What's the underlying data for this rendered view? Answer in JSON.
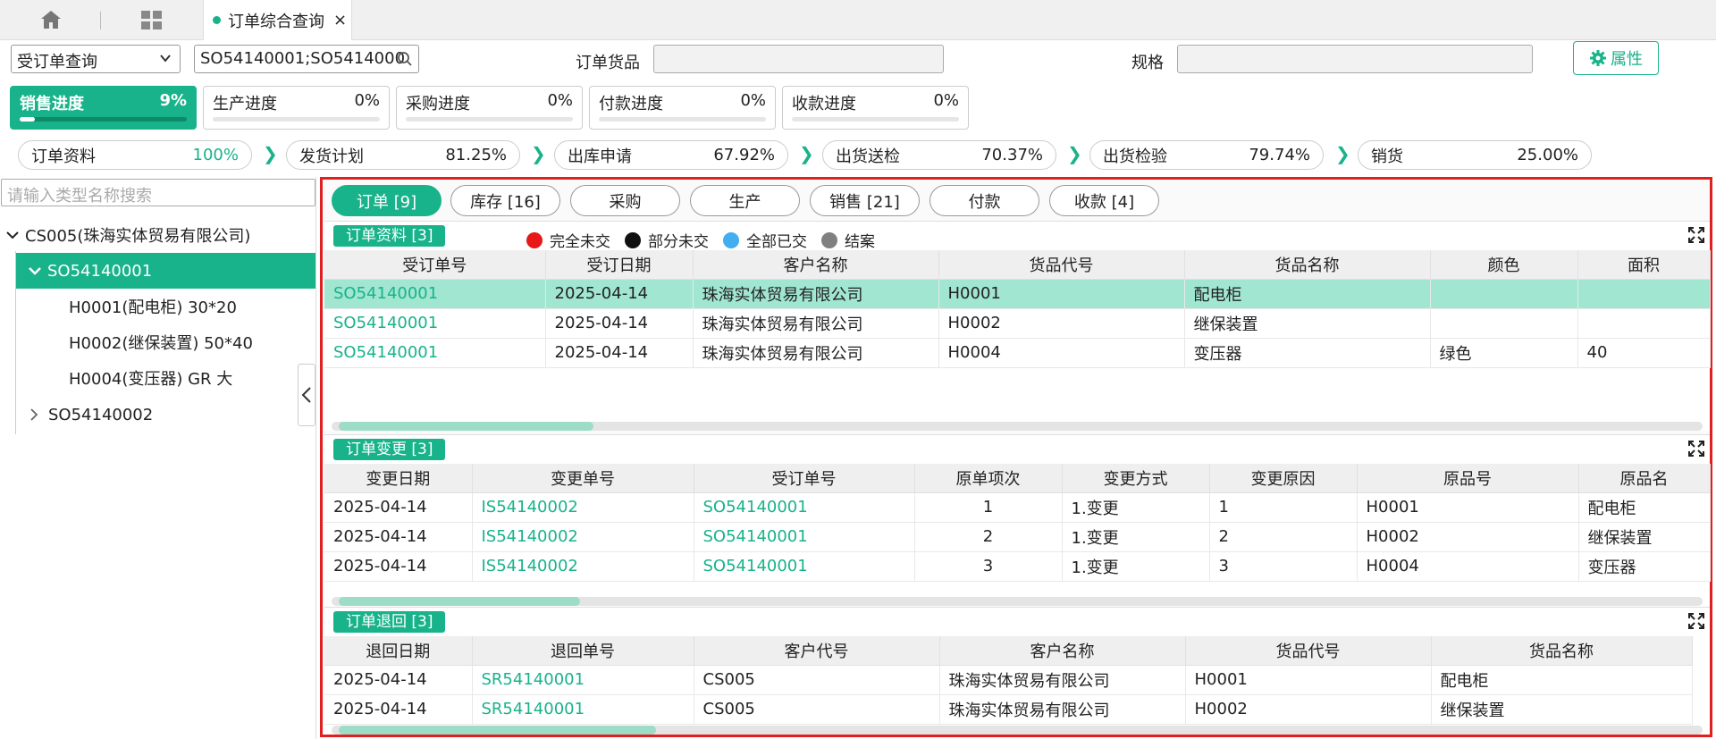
{
  "topbar": {
    "tab_label": "订单综合查询",
    "close": "×"
  },
  "filters": {
    "query_type": "受订单查询",
    "search_value": "SO54140001;SO5414000",
    "goods_label": "订单货品",
    "spec_label": "规格",
    "attr_button": "属性"
  },
  "progress": [
    {
      "label": "销售进度",
      "value": "9%",
      "fraction": 0.09
    },
    {
      "label": "生产进度",
      "value": "0%",
      "fraction": 0
    },
    {
      "label": "采购进度",
      "value": "0%",
      "fraction": 0
    },
    {
      "label": "付款进度",
      "value": "0%",
      "fraction": 0
    },
    {
      "label": "收款进度",
      "value": "0%",
      "fraction": 0
    }
  ],
  "steps": [
    {
      "label": "订单资料",
      "value": "100%"
    },
    {
      "label": "发货计划",
      "value": "81.25%"
    },
    {
      "label": "出库申请",
      "value": "67.92%"
    },
    {
      "label": "出货送检",
      "value": "70.37%"
    },
    {
      "label": "出货检验",
      "value": "79.74%"
    },
    {
      "label": "销货",
      "value": "25.00%"
    }
  ],
  "left": {
    "search_placeholder": "请输入类型名称搜索",
    "tree": {
      "root": "CS005(珠海实体贸易有限公司)",
      "order1": "SO54140001",
      "items": [
        "H0001(配电柜) 30*20",
        "H0002(继保装置) 50*40",
        "H0004(变压器) GR 大"
      ],
      "order2": "SO54140002"
    }
  },
  "panel_tabs": [
    "订单 [9]",
    "库存 [16]",
    "采购",
    "生产",
    "销售 [21]",
    "付款",
    "收款 [4]"
  ],
  "order_section": {
    "title": "订单资料 [3]",
    "legend": [
      {
        "label": "完全未交",
        "color": "#e81818"
      },
      {
        "label": "部分未交",
        "color": "#111111"
      },
      {
        "label": "全部已交",
        "color": "#40aef0"
      },
      {
        "label": "结案",
        "color": "#808080"
      }
    ],
    "headers": [
      "受订单号",
      "受订日期",
      "客户名称",
      "货品代号",
      "货品名称",
      "颜色",
      "面积"
    ],
    "rows": [
      [
        "SO54140001",
        "2025-04-14",
        "珠海实体贸易有限公司",
        "H0001",
        "配电柜",
        "",
        ""
      ],
      [
        "SO54140001",
        "2025-04-14",
        "珠海实体贸易有限公司",
        "H0002",
        "继保装置",
        "",
        ""
      ],
      [
        "SO54140001",
        "2025-04-14",
        "珠海实体贸易有限公司",
        "H0004",
        "变压器",
        "绿色",
        "40"
      ]
    ]
  },
  "change_section": {
    "title": "订单变更 [3]",
    "headers": [
      "变更日期",
      "变更单号",
      "受订单号",
      "原单项次",
      "变更方式",
      "变更原因",
      "原品号",
      "原品名"
    ],
    "rows": [
      [
        "2025-04-14",
        "IS54140002",
        "SO54140001",
        "1",
        "1.变更",
        "1",
        "H0001",
        "配电柜"
      ],
      [
        "2025-04-14",
        "IS54140002",
        "SO54140001",
        "2",
        "1.变更",
        "2",
        "H0002",
        "继保装置"
      ],
      [
        "2025-04-14",
        "IS54140002",
        "SO54140001",
        "3",
        "1.变更",
        "3",
        "H0004",
        "变压器"
      ]
    ]
  },
  "return_section": {
    "title": "订单退回 [3]",
    "headers": [
      "退回日期",
      "退回单号",
      "客户代号",
      "客户名称",
      "货品代号",
      "货品名称"
    ],
    "rows": [
      [
        "2025-04-14",
        "SR54140001",
        "CS005",
        "珠海实体贸易有限公司",
        "H0001",
        "配电柜"
      ],
      [
        "2025-04-14",
        "SR54140001",
        "CS005",
        "珠海实体贸易有限公司",
        "H0002",
        "继保装置"
      ]
    ]
  }
}
